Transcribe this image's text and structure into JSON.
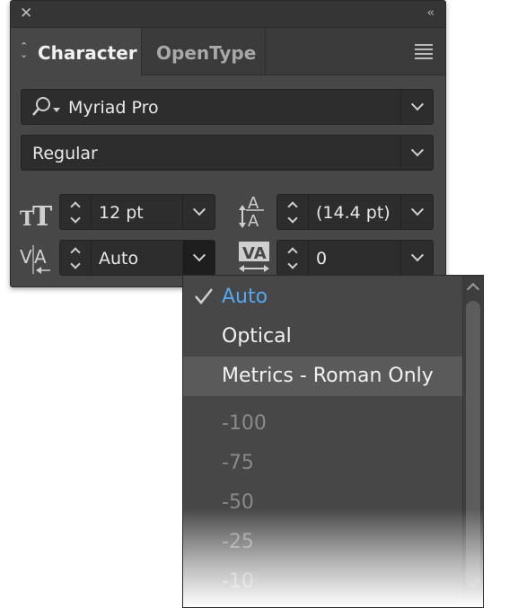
{
  "panel": {
    "tabs": [
      {
        "label": "Character",
        "active": true
      },
      {
        "label": "OpenType",
        "active": false
      }
    ],
    "font_family": "Myriad Pro",
    "font_style": "Regular",
    "font_size": "12 pt",
    "leading": "(14.4 pt)",
    "kerning": "Auto",
    "tracking": "0"
  },
  "icons": {
    "close": "close-icon",
    "collapse": "collapse-icon",
    "menu": "panel-menu-icon",
    "search": "font-search-icon",
    "font_size": "font-size-icon",
    "leading": "leading-icon",
    "kerning": "kerning-icon",
    "tracking": "tracking-icon"
  },
  "kerning_menu": {
    "items": [
      {
        "label": "Auto",
        "checked": true
      },
      {
        "label": "Optical",
        "checked": false
      },
      {
        "label": "Metrics - Roman Only",
        "checked": false,
        "highlighted": true
      },
      {
        "label": "-100",
        "dim": true
      },
      {
        "label": "-75",
        "dim": true
      },
      {
        "label": "-50",
        "dim": true
      },
      {
        "label": "-25",
        "dim": true
      },
      {
        "label": "-10",
        "dim": true
      }
    ]
  },
  "colors": {
    "panel_bg": "#474747",
    "field_bg": "#2d2d2d",
    "selected_text": "#54a8ee",
    "highlight_bg": "#5a5a5a"
  }
}
